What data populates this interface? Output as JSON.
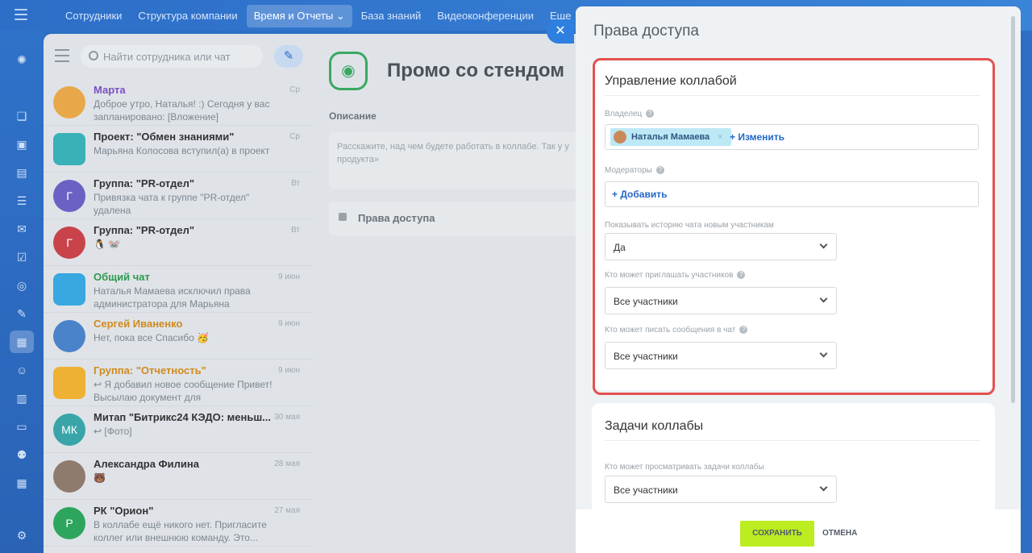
{
  "topnav": {
    "items": [
      {
        "label": "Сотрудники"
      },
      {
        "label": "Структура компании"
      },
      {
        "label": "Время и Отчеты ⌄"
      },
      {
        "label": "База знаний"
      },
      {
        "label": "Видеоконференции"
      },
      {
        "label": "Еще ⌄"
      }
    ]
  },
  "rail": {
    "icons": [
      "activity-icon",
      "chat-icon",
      "tasks-icon",
      "documents-icon",
      "crm-icon",
      "mail-icon",
      "checklist-icon",
      "target-icon",
      "sign-icon",
      "messenger-icon",
      "people-icon",
      "files-icon",
      "card-icon",
      "robot-icon",
      "calendar-icon",
      "settings-icon"
    ]
  },
  "chatlist": {
    "search_placeholder": "Найти сотрудника или чат",
    "items": [
      {
        "name": "Марта",
        "date": "Ср",
        "message": "Доброе утро, Наталья! :) Сегодня у вас запланировано: [Вложение]",
        "avatar_color": "#e8a84a",
        "avatar_text": ""
      },
      {
        "name": "Проект: \"Обмен знаниями\"",
        "date": "Ср",
        "message": "Марьяна Колосова вступил(а) в проект",
        "avatar_color": "#3ab0b8",
        "avatar_text": ""
      },
      {
        "name": "Группа: \"PR-отдел\"",
        "date": "Вт",
        "message": "Привязка чата к группе \"PR-отдел\" удалена",
        "avatar_color": "#6b61c4",
        "avatar_text": "Г"
      },
      {
        "name": "Группа: \"PR-отдел\"",
        "date": "Вт",
        "message": "🐧 🐭",
        "avatar_color": "#c9434b",
        "avatar_text": "Г"
      },
      {
        "name": "Общий чат",
        "date": "9 июн",
        "message": "Наталья Мамаева исключил права администратора для Марьяна Колосова.",
        "avatar_color": "#39a7e0",
        "avatar_text": ""
      },
      {
        "name": "Сергей Иваненко",
        "date": "9 июн",
        "message": "Нет, пока все Спасибо 🥳",
        "avatar_color": "#4a83c9",
        "avatar_text": ""
      },
      {
        "name": "Группа: \"Отчетность\"",
        "date": "9 июн",
        "message": "↩ Я добавил новое сообщение Привет! Высылаю документ для ознакомления....",
        "avatar_color": "#efb133",
        "avatar_text": ""
      },
      {
        "name": "Митап \"Битрикс24 КЭДО: меньш...",
        "date": "30 мая",
        "message": "↩ [Фото]",
        "avatar_color": "#3aa5a8",
        "avatar_text": "МК"
      },
      {
        "name": "Александра Филина",
        "date": "28 мая",
        "message": "🐻",
        "avatar_color": "#8f7a6e",
        "avatar_text": ""
      },
      {
        "name": "РК \"Орион\"",
        "date": "27 мая",
        "message": "В коллабе ещё никого нет. Пригласите коллег или внешнюю команду. Это...",
        "avatar_color": "#2ea55e",
        "avatar_text": "Р"
      }
    ]
  },
  "collab": {
    "title": "Промо со стендом",
    "description_label": "Описание",
    "description_placeholder": "Расскажите, над чем будете работать в коллабе. Так у у продукта»",
    "access_label": "Права доступа"
  },
  "slider": {
    "title": "Права доступа",
    "card1": {
      "title": "Управление коллабой",
      "owner_label": "Владелец",
      "owner_name": "Наталья Мамаева",
      "owner_change": "+ Изменить",
      "moderators_label": "Модераторы",
      "moderators_add": "+ Добавить",
      "history_label": "Показывать историю чата новым участникам",
      "history_value": "Да",
      "invite_label": "Кто может приглашать участников",
      "invite_value": "Все участники",
      "write_label": "Кто может писать сообщения в чат",
      "write_value": "Все участники"
    },
    "card2": {
      "title": "Задачи коллабы",
      "view_label": "Кто может просматривать задачи коллабы",
      "view_value": "Все участники"
    }
  },
  "footer": {
    "save": "СОХРАНИТЬ",
    "cancel": "ОТМЕНА"
  },
  "colors": {
    "accent": "#2f7fe0",
    "highlight_frame": "#e3514f",
    "save_button": "#bbed21"
  }
}
